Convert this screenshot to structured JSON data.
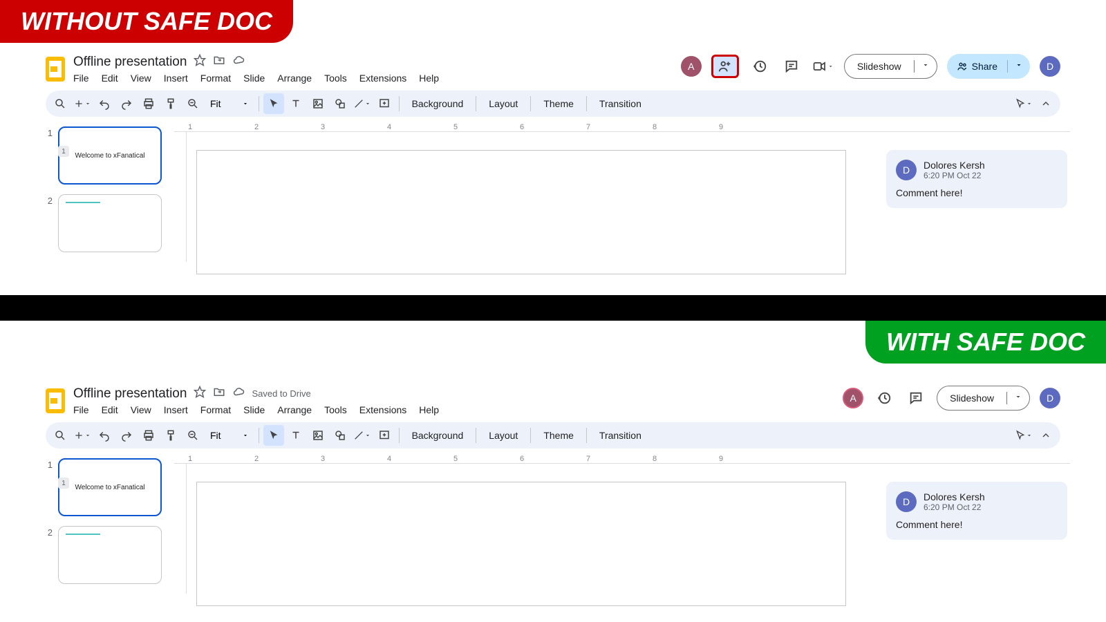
{
  "banners": {
    "without": "WITHOUT SAFE DOC",
    "with": "WITH SAFE DOC"
  },
  "doc": {
    "title": "Offline presentation",
    "saved": "Saved to Drive"
  },
  "menus": {
    "file": "File",
    "edit": "Edit",
    "view": "View",
    "insert": "Insert",
    "format": "Format",
    "slide": "Slide",
    "arrange": "Arrange",
    "tools": "Tools",
    "extensions": "Extensions",
    "help": "Help"
  },
  "actions": {
    "slideshow": "Slideshow",
    "share": "Share"
  },
  "toolbar": {
    "zoom": "Fit",
    "background": "Background",
    "layout": "Layout",
    "theme": "Theme",
    "transition": "Transition"
  },
  "thumbs": {
    "slide1_text": "Welcome to xFanatical",
    "num1": "1",
    "num2": "2",
    "badge1": "1"
  },
  "ruler": [
    "1",
    "2",
    "3",
    "4",
    "5",
    "6",
    "7",
    "8",
    "9"
  ],
  "comment": {
    "author": "Dolores Kersh",
    "time": "6:20 PM Oct 22",
    "body": "Comment here!",
    "initial": "D"
  },
  "avatars": {
    "a": "A",
    "d": "D"
  }
}
